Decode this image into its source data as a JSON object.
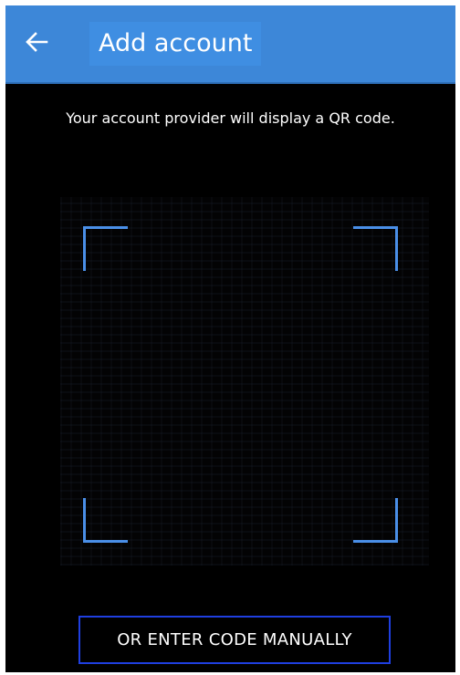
{
  "header": {
    "title": "Add account",
    "back_icon": "arrow-left-icon",
    "color": "#3d87d8"
  },
  "main": {
    "instruction": "Your account provider will display a QR code.",
    "scanner_frame_color": "#4a8fe8",
    "manual_button_label": "OR ENTER CODE MANUALLY",
    "manual_button_border_color": "#1f3fe0"
  }
}
